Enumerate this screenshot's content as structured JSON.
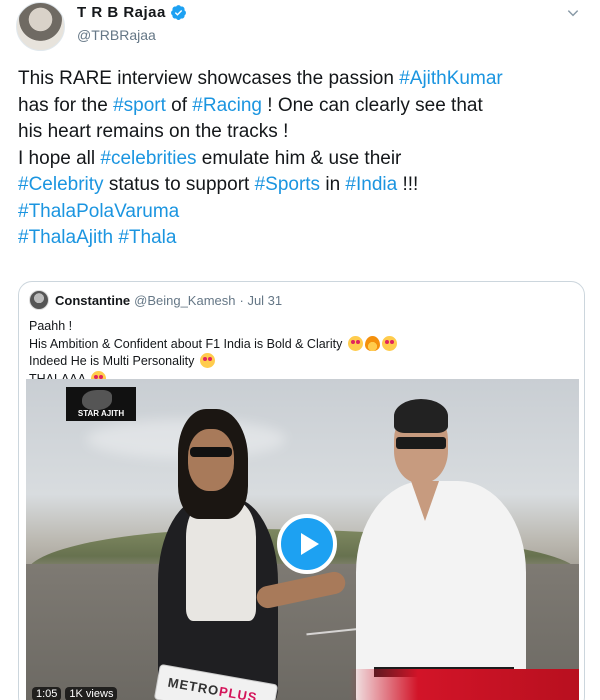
{
  "author": {
    "display_name": "T R B Rajaa",
    "handle": "@TRBRajaa",
    "verified": true
  },
  "icons": {
    "verified": "verified-badge-icon",
    "menu": "chevron-down-icon",
    "play": "play-icon"
  },
  "colors": {
    "link": "#1b95e0",
    "verified": "#1da1f2",
    "play_button": "#1da1f2",
    "secondary_text": "#657786"
  },
  "tweet": {
    "lines": [
      [
        {
          "t": "This RARE interview showcases the passion "
        },
        {
          "t": "#AjithKumar",
          "tag": true
        }
      ],
      [
        {
          "t": "has for the "
        },
        {
          "t": "#sport",
          "tag": true
        },
        {
          "t": " of "
        },
        {
          "t": "#Racing",
          "tag": true
        },
        {
          "t": " ! One can clearly see that"
        }
      ],
      [
        {
          "t": "his heart remains on the tracks !"
        }
      ],
      [
        {
          "t": "I hope all "
        },
        {
          "t": "#celebrities",
          "tag": true
        },
        {
          "t": " emulate him & use their"
        }
      ],
      [
        {
          "t": "#Celebrity",
          "tag": true
        },
        {
          "t": " status to support "
        },
        {
          "t": "#Sports",
          "tag": true
        },
        {
          "t": " in "
        },
        {
          "t": "#India",
          "tag": true
        },
        {
          "t": " !!!"
        }
      ],
      [
        {
          "t": "#ThalaPolaVaruma",
          "tag": true
        }
      ],
      [
        {
          "t": "#ThalaAjith",
          "tag": true
        },
        {
          "t": " "
        },
        {
          "t": "#Thala",
          "tag": true
        }
      ]
    ]
  },
  "quoted": {
    "display_name": "Constantine",
    "handle": "@Being_Kamesh",
    "date": "· Jul 31",
    "lines": [
      {
        "text": "Paahh !",
        "emoji": []
      },
      {
        "text": "His Ambition & Confident about F1 India is Bold & Clarity ",
        "emoji": [
          "heart-eyes",
          "fire",
          "heart-eyes"
        ]
      },
      {
        "text": "Indeed He is Multi Personality  ",
        "emoji": [
          "heart-eyes"
        ]
      },
      {
        "text": "THALAAA ",
        "emoji": [
          "heart-eyes"
        ]
      }
    ],
    "video": {
      "channel_badge": "STAR AJITH",
      "mic_brand_a": "METRO",
      "mic_brand_b": "PLUS",
      "duration": "1:05",
      "views": "1K views"
    }
  }
}
